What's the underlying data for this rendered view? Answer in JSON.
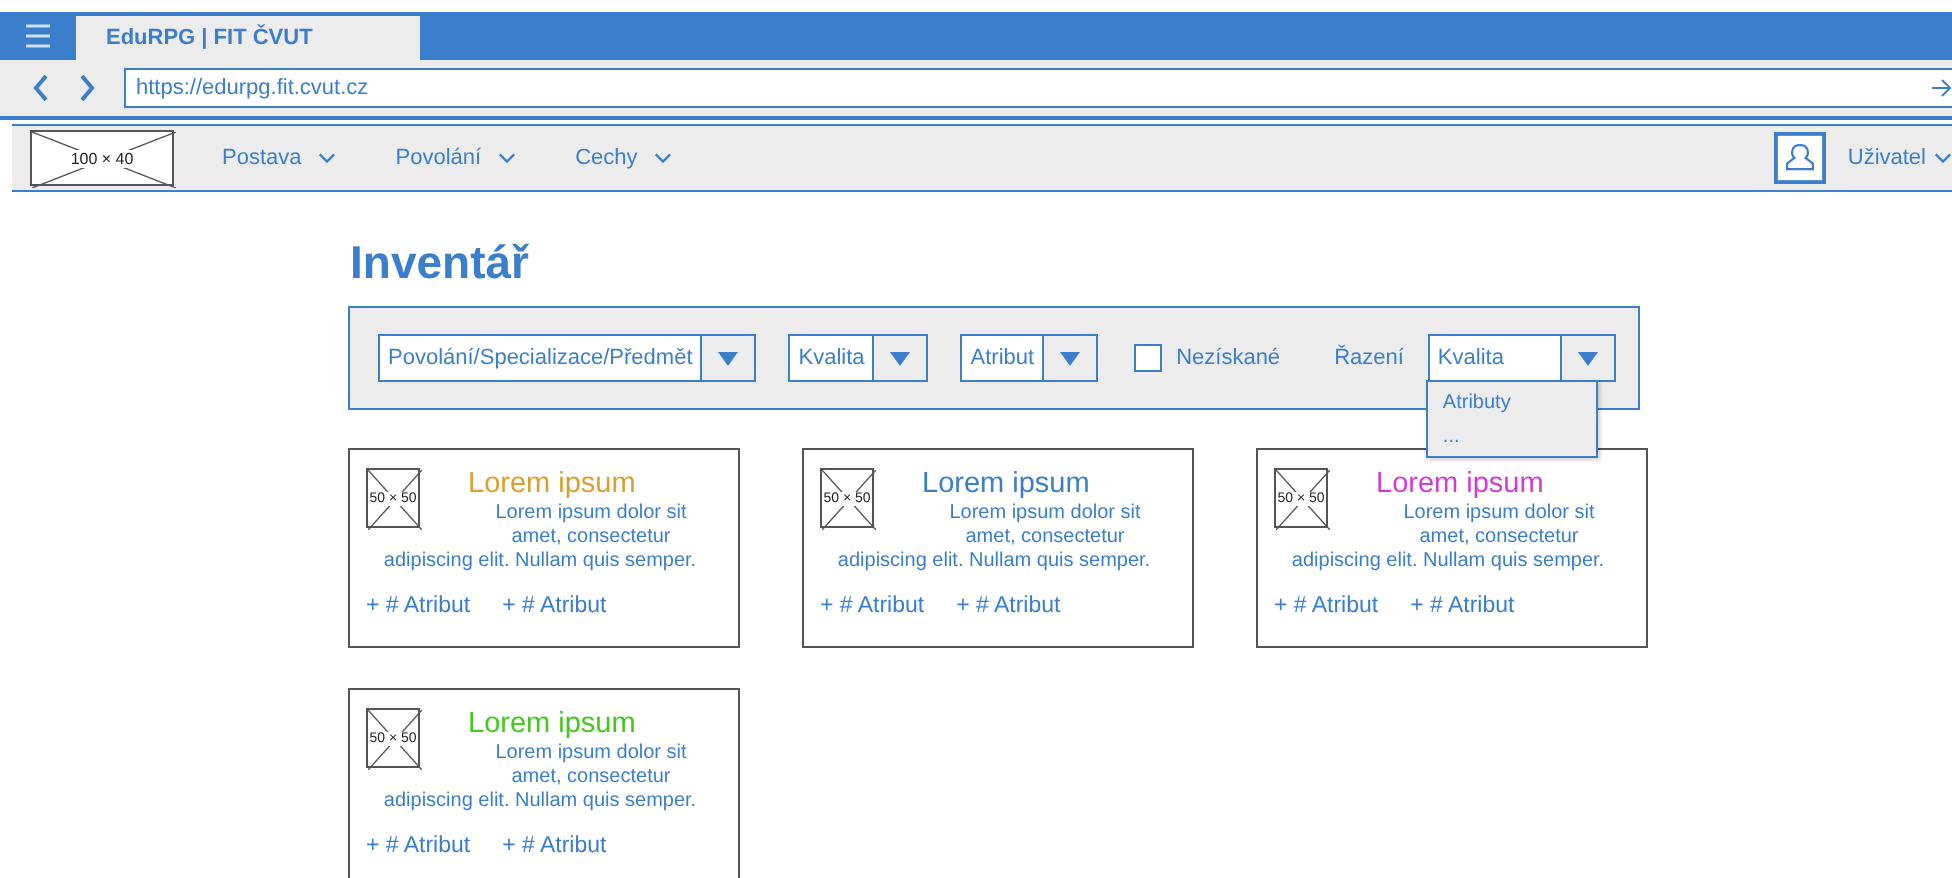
{
  "browser": {
    "tab_title": "EduRPG | FIT ČVUT",
    "url": "https://edurpg.fit.cvut.cz"
  },
  "navbar": {
    "logo_placeholder": "100 × 40",
    "menu": [
      {
        "label": "Postava"
      },
      {
        "label": "Povolání"
      },
      {
        "label": "Cechy"
      }
    ],
    "user": "Uživatel"
  },
  "page_title": "Inventář",
  "filters": {
    "selects": [
      {
        "value": "Povolání/Specializace/Předmět"
      },
      {
        "value": "Kvalita"
      },
      {
        "value": "Atribut"
      }
    ],
    "unobtained": {
      "label": "Nezískané",
      "checked": false
    },
    "sort": {
      "label": "Řazení",
      "value": "Kvalita",
      "expanded": true,
      "options": [
        "Atributy",
        "..."
      ]
    }
  },
  "items": [
    {
      "image_placeholder": "50 × 50",
      "title": "Lorem ipsum",
      "color": "#d9a032",
      "description": "Lorem ipsum dolor sit amet, consectetur adipiscing elit. Nullam quis semper.",
      "attributes": [
        "+ # Atribut",
        "+ # Atribut"
      ]
    },
    {
      "image_placeholder": "50 × 50",
      "title": "Lorem ipsum",
      "color": "#3b7fcc",
      "description": "Lorem ipsum dolor sit amet, consectetur adipiscing elit. Nullam quis semper.",
      "attributes": [
        "+ # Atribut",
        "+ # Atribut"
      ]
    },
    {
      "image_placeholder": "50 × 50",
      "title": "Lorem ipsum",
      "color": "#d63ad6",
      "description": "Lorem ipsum dolor sit amet, consectetur adipiscing elit. Nullam quis semper.",
      "attributes": [
        "+ # Atribut",
        "+ # Atribut"
      ]
    },
    {
      "image_placeholder": "50 × 50",
      "title": "Lorem ipsum",
      "color": "#44c81e",
      "description": "Lorem ipsum dolor sit amet, consectetur adipiscing elit. Nullam quis semper.",
      "attributes": [
        "+ # Atribut",
        "+ # Atribut"
      ]
    }
  ]
}
